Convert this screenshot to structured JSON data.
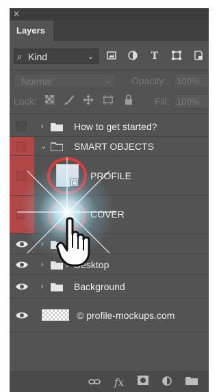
{
  "panel": {
    "close_glyph": "×",
    "tab_label": "Layers"
  },
  "filter": {
    "search_glyph": "⌕",
    "kind_label": "Kind",
    "chevron_glyph": "⌄",
    "icons": [
      "image-filter-icon",
      "adjustment-filter-icon",
      "type-filter-icon",
      "shape-filter-icon",
      "smart-object-filter-icon"
    ],
    "type_glyph": "T"
  },
  "blend": {
    "mode_label": "Normal",
    "opacity_label": "Opacity:",
    "opacity_value": "100%"
  },
  "lock": {
    "label": "Lock:",
    "fill_label": "Fill:",
    "fill_value": "100%"
  },
  "layers": [
    {
      "name": "How to get started?",
      "type": "group",
      "expanded": false,
      "visible": false
    },
    {
      "name": "SMART OBJECTS",
      "type": "group",
      "expanded": true,
      "visible": false
    },
    {
      "name": "PROFILE",
      "type": "smart-object",
      "visible": false
    },
    {
      "name": "COVER",
      "type": "smart-object",
      "visible": false
    },
    {
      "name": "",
      "type": "group",
      "expanded": false,
      "visible": true
    },
    {
      "name": "Desktop",
      "type": "group",
      "expanded": false,
      "visible": true
    },
    {
      "name": "Background",
      "type": "group",
      "expanded": false,
      "visible": true
    },
    {
      "name": "© profile-mockups.com",
      "type": "layer",
      "visible": true
    }
  ],
  "colors": {
    "panel_bg": "#535353",
    "hidden_highlight": "#b14747",
    "ring": "#e03a3a"
  },
  "footer": {
    "fx_label": "fx"
  }
}
